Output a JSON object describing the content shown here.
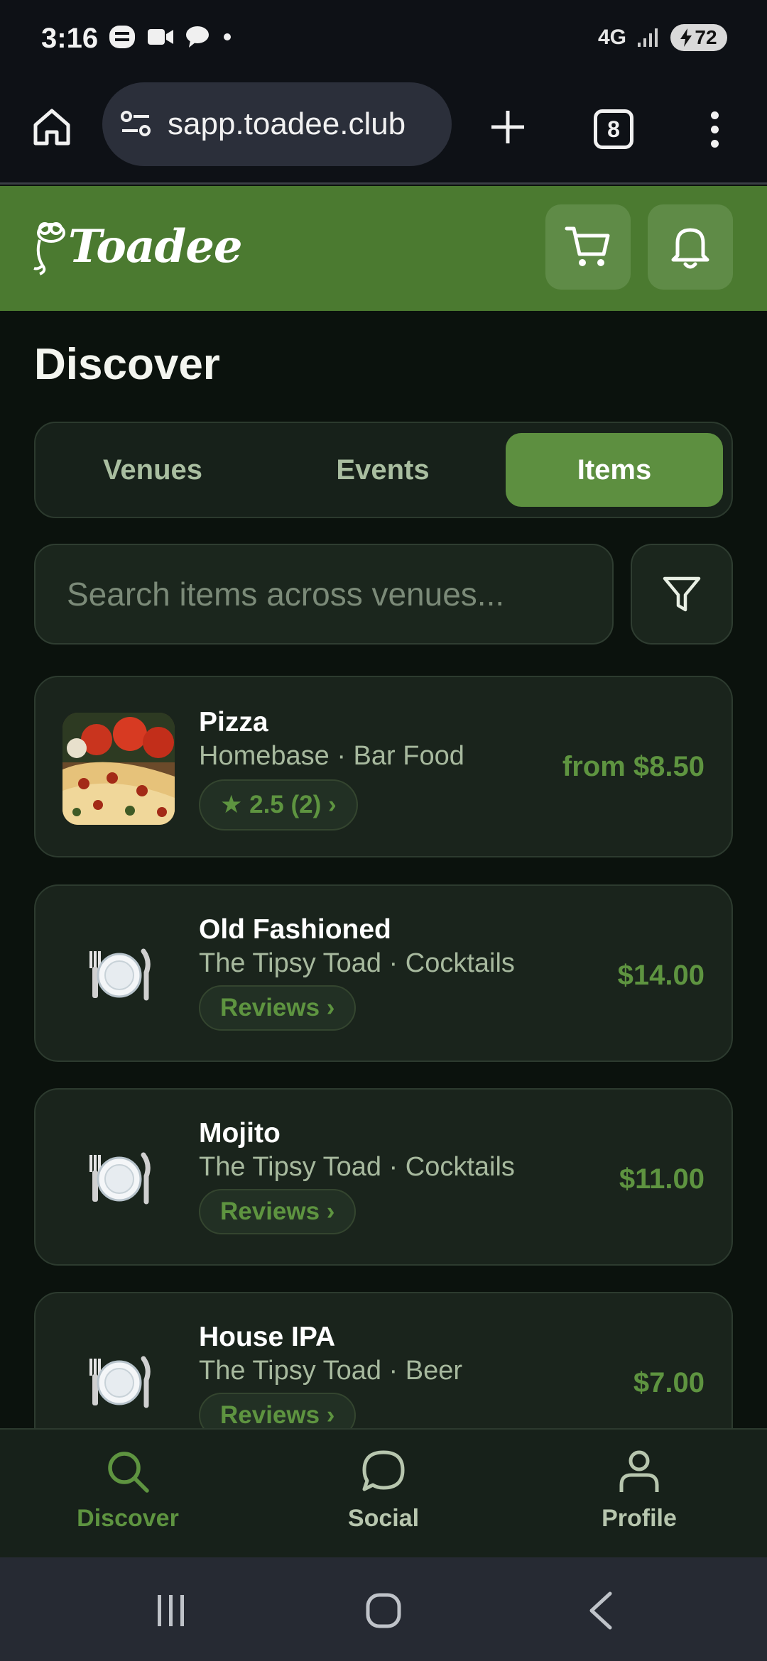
{
  "status_bar": {
    "time": "3:16",
    "network": "4G",
    "battery": "72"
  },
  "browser": {
    "url": "sapp.toadee.club",
    "tab_count": "8"
  },
  "app": {
    "logo_text": "Toadee",
    "brand_color": "#4b7a30",
    "accent_color": "#5e9440"
  },
  "page": {
    "title": "Discover",
    "tabs": [
      {
        "label": "Venues",
        "active": false
      },
      {
        "label": "Events",
        "active": false
      },
      {
        "label": "Items",
        "active": true
      }
    ],
    "search_placeholder": "Search items across venues..."
  },
  "items": [
    {
      "name": "Pizza",
      "meta": "Homebase · Bar Food",
      "pill": "★ 2.5 (2) ›",
      "price": "from $8.50",
      "image": "pizza-photo"
    },
    {
      "name": "Old Fashioned",
      "meta": "The Tipsy Toad · Cocktails",
      "pill": "Reviews ›",
      "price": "$14.00",
      "image": "plate-icon"
    },
    {
      "name": "Mojito",
      "meta": "The Tipsy Toad · Cocktails",
      "pill": "Reviews ›",
      "price": "$11.00",
      "image": "plate-icon"
    },
    {
      "name": "House IPA",
      "meta": "The Tipsy Toad · Beer",
      "pill": "Reviews ›",
      "price": "$7.00",
      "image": "plate-icon"
    }
  ],
  "bottom_nav": [
    {
      "label": "Discover",
      "icon": "search-icon",
      "active": true
    },
    {
      "label": "Social",
      "icon": "chat-bubble-icon",
      "active": false
    },
    {
      "label": "Profile",
      "icon": "person-icon",
      "active": false
    }
  ]
}
